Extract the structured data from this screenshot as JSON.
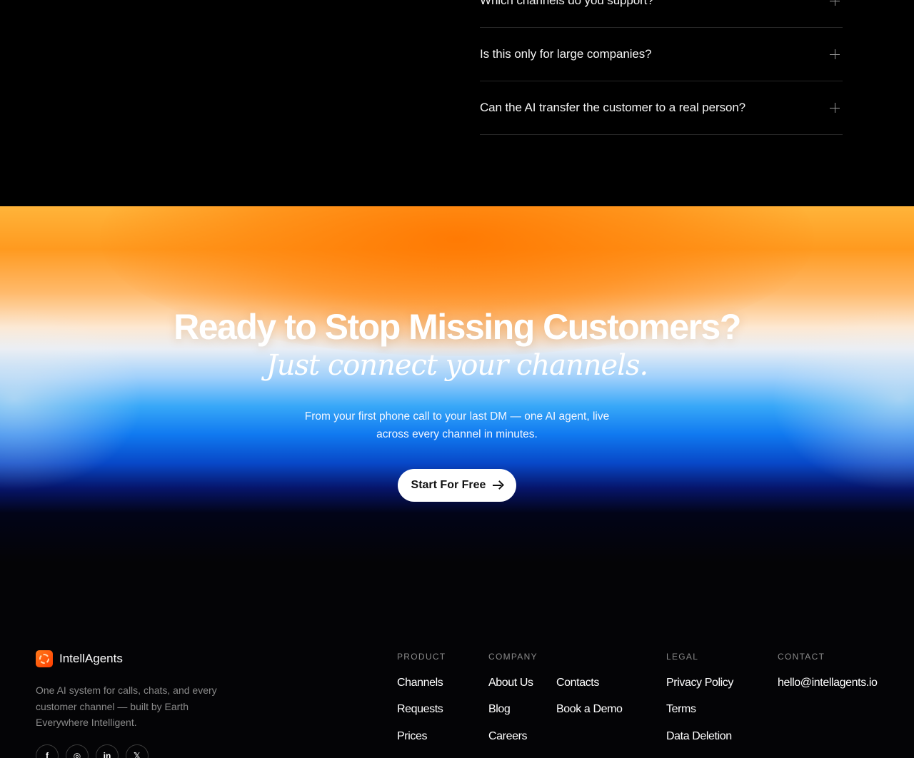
{
  "faq": {
    "items": [
      {
        "question": "Which channels do you support?"
      },
      {
        "question": "Is this only for large companies?"
      },
      {
        "question": "Can the AI transfer the customer to a real person?"
      }
    ]
  },
  "cta": {
    "title": "Ready to Stop Missing Customers?",
    "subtitle": "Just connect your channels.",
    "description": "From your first phone call to your last DM — one AI agent, live across every channel in minutes.",
    "button_label": "Start For Free"
  },
  "footer": {
    "brand_name": "IntellAgents",
    "tagline": "One AI system for calls, chats, and every customer channel — built by Earth Everywhere Intelligent.",
    "socials": [
      {
        "icon": "facebook-icon",
        "glyph": "f"
      },
      {
        "icon": "instagram-icon",
        "glyph": "◎"
      },
      {
        "icon": "linkedin-icon",
        "glyph": "in"
      },
      {
        "icon": "x-icon",
        "glyph": "𝕏"
      }
    ],
    "product": {
      "heading": "PRODUCT",
      "links": [
        "Channels",
        "Requests",
        "Prices"
      ]
    },
    "company": {
      "heading": "COMPANY",
      "links": [
        "About Us",
        "Blog",
        "Careers",
        "Contacts",
        "Book a Demo"
      ]
    },
    "legal": {
      "heading": "LEGAL",
      "links": [
        "Privacy Policy",
        "Terms",
        "Data Deletion"
      ]
    },
    "contact": {
      "heading": "CONTACT",
      "email": "hello@intellagents.io"
    }
  }
}
